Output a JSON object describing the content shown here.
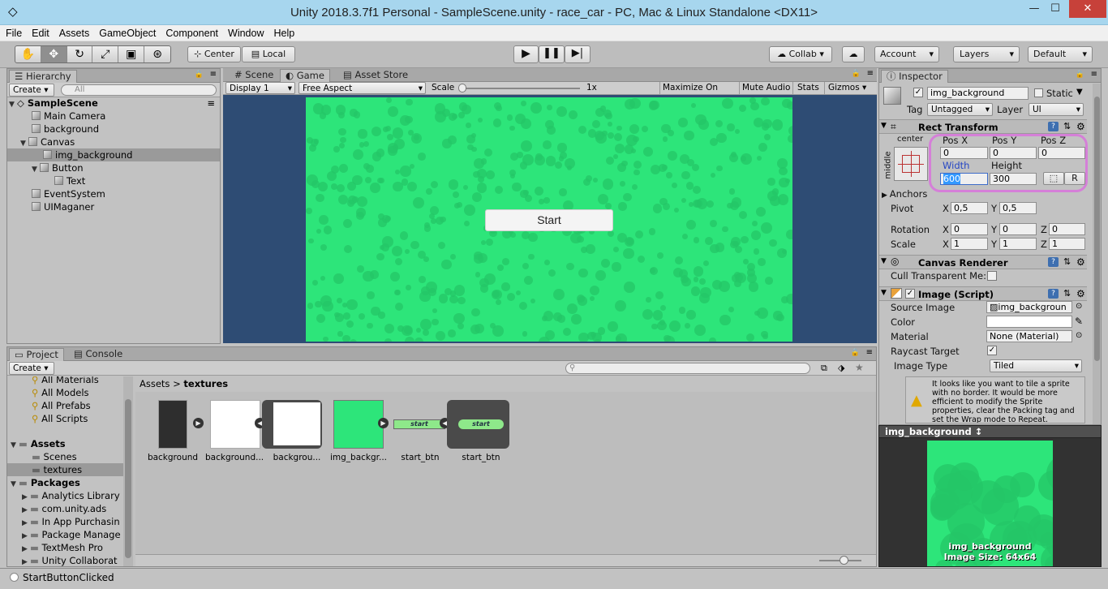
{
  "window": {
    "title": "Unity 2018.3.7f1 Personal - SampleScene.unity - race_car - PC, Mac & Linux Standalone <DX11>",
    "min": "—",
    "max": "☐",
    "close": "✕"
  },
  "menu": [
    "File",
    "Edit",
    "Assets",
    "GameObject",
    "Component",
    "Window",
    "Help"
  ],
  "toolbar": {
    "center": "Center",
    "local": "Local",
    "collab": "Collab ▾",
    "account": "Account",
    "layers": "Layers",
    "layout": "Default",
    "caret": "▾"
  },
  "hierarchy": {
    "tab": "Hierarchy",
    "create": "Create ▾",
    "search_placeholder": "All",
    "scene": "SampleScene",
    "items": [
      {
        "label": "Main Camera"
      },
      {
        "label": "background"
      },
      {
        "label": "Canvas"
      },
      {
        "label": "img_background"
      },
      {
        "label": "Button"
      },
      {
        "label": "Text"
      },
      {
        "label": "EventSystem"
      },
      {
        "label": "UIMaganer"
      }
    ]
  },
  "viewtabs": {
    "scene": "Scene",
    "game": "Game",
    "store": "Asset Store"
  },
  "gamebar": {
    "display": "Display 1",
    "aspect": "Free Aspect",
    "scale": "Scale",
    "scale_val": "1x",
    "maximize": "Maximize On Play",
    "mute": "Mute Audio",
    "stats": "Stats",
    "gizmos": "Gizmos ▾"
  },
  "game": {
    "button_label": "Start"
  },
  "project": {
    "tab": "Project",
    "console_tab": "Console",
    "create": "Create ▾",
    "favorites": [
      "All Materials",
      "All Models",
      "All Prefabs",
      "All Scripts"
    ],
    "assets_header": "Assets",
    "assets_children": [
      "Scenes",
      "textures"
    ],
    "packages_header": "Packages",
    "packages": [
      "Analytics Library",
      "com.unity.ads",
      "In App Purchasin",
      "Package Manage",
      "TextMesh Pro",
      "Unity Collaborat"
    ],
    "breadcrumb_root": "Assets",
    "breadcrumb_leaf": "textures",
    "assets": [
      {
        "label": "background"
      },
      {
        "label": "background..."
      },
      {
        "label": "backgrou..."
      },
      {
        "label": "img_backgr..."
      },
      {
        "label": "start_btn"
      },
      {
        "label": "start_btn"
      }
    ],
    "start_label": "start"
  },
  "inspector": {
    "tab": "Inspector",
    "object_name": "img_background",
    "static_label": "Static",
    "tag_label": "Tag",
    "tag_value": "Untagged",
    "layer_label": "Layer",
    "layer_value": "UI",
    "rect": {
      "title": "Rect Transform",
      "anchor_h": "center",
      "anchor_v": "middle",
      "posx_label": "Pos X",
      "posy_label": "Pos Y",
      "posz_label": "Pos Z",
      "posx": "0",
      "posy": "0",
      "posz": "0",
      "width_label": "Width",
      "height_label": "Height",
      "width": "600",
      "height": "300",
      "r_btn": "R",
      "anchors": "Anchors",
      "pivot": "Pivot",
      "pivot_x": "0,5",
      "pivot_y": "0,5",
      "rotation": "Rotation",
      "rot_x": "0",
      "rot_y": "0",
      "rot_z": "0",
      "scale": "Scale",
      "scale_x": "1",
      "scale_y": "1",
      "scale_z": "1",
      "x": "X",
      "y": "Y",
      "z": "Z"
    },
    "canvas_renderer": {
      "title": "Canvas Renderer",
      "cull": "Cull Transparent Me:"
    },
    "image": {
      "title": "Image (Script)",
      "source_label": "Source Image",
      "source_value": "img_backgroun",
      "color_label": "Color",
      "material_label": "Material",
      "material_value": "None (Material)",
      "raycast_label": "Raycast Target",
      "type_label": "Image Type",
      "type_value": "Tiled",
      "warning": "It looks like you want to tile a sprite with no border. It would be more efficient to modify the Sprite properties, clear the Packing tag and set the Wrap mode to Repeat."
    },
    "preview": {
      "title": "img_background ↕",
      "name": "img_background",
      "size": "Image Size: 64x64"
    }
  },
  "status": {
    "text": "StartButtonClicked"
  },
  "colors": {
    "game_green": "#2de57a",
    "game_bg": "#2e4c74",
    "title_bar": "#a7d6ee",
    "highlight": "#d57fd8"
  }
}
